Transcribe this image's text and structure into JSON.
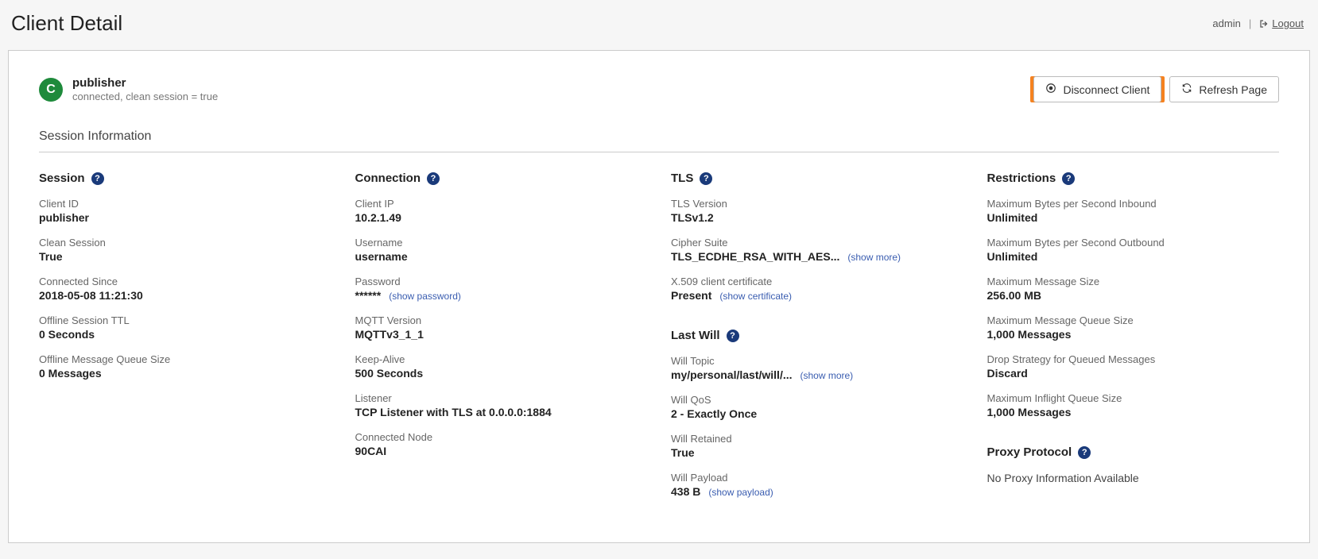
{
  "header": {
    "page_title": "Client Detail",
    "user": "admin",
    "logout": "Logout"
  },
  "client": {
    "avatar_letter": "C",
    "name": "publisher",
    "subtitle": "connected, clean session = true"
  },
  "buttons": {
    "disconnect": "Disconnect Client",
    "refresh": "Refresh Page"
  },
  "section_title": "Session Information",
  "groups": {
    "session": {
      "title": "Session",
      "client_id_label": "Client ID",
      "client_id": "publisher",
      "clean_session_label": "Clean Session",
      "clean_session": "True",
      "connected_since_label": "Connected Since",
      "connected_since": "2018-05-08 11:21:30",
      "offline_ttl_label": "Offline Session TTL",
      "offline_ttl": "0 Seconds",
      "offline_queue_label": "Offline Message Queue Size",
      "offline_queue": "0 Messages"
    },
    "connection": {
      "title": "Connection",
      "client_ip_label": "Client IP",
      "client_ip": "10.2.1.49",
      "username_label": "Username",
      "username": "username",
      "password_label": "Password",
      "password": "******",
      "password_link": "(show password)",
      "mqtt_version_label": "MQTT Version",
      "mqtt_version": "MQTTv3_1_1",
      "keep_alive_label": "Keep-Alive",
      "keep_alive": "500 Seconds",
      "listener_label": "Listener",
      "listener": "TCP Listener with TLS at 0.0.0.0:1884",
      "node_label": "Connected Node",
      "node": "90CAI"
    },
    "tls": {
      "title": "TLS",
      "version_label": "TLS Version",
      "version": "TLSv1.2",
      "cipher_label": "Cipher Suite",
      "cipher": "TLS_ECDHE_RSA_WITH_AES...",
      "cipher_link": "(show more)",
      "cert_label": "X.509 client certificate",
      "cert": "Present",
      "cert_link": "(show certificate)"
    },
    "last_will": {
      "title": "Last Will",
      "topic_label": "Will Topic",
      "topic": "my/personal/last/will/...",
      "topic_link": "(show more)",
      "qos_label": "Will QoS",
      "qos": "2 - Exactly Once",
      "retained_label": "Will Retained",
      "retained": "True",
      "payload_label": "Will Payload",
      "payload": "438 B",
      "payload_link": "(show payload)"
    },
    "restrictions": {
      "title": "Restrictions",
      "inbound_label": "Maximum Bytes per Second Inbound",
      "inbound": "Unlimited",
      "outbound_label": "Maximum Bytes per Second Outbound",
      "outbound": "Unlimited",
      "msg_size_label": "Maximum Message Size",
      "msg_size": "256.00 MB",
      "queue_size_label": "Maximum Message Queue Size",
      "queue_size": "1,000 Messages",
      "drop_label": "Drop Strategy for Queued Messages",
      "drop": "Discard",
      "inflight_label": "Maximum Inflight Queue Size",
      "inflight": "1,000 Messages"
    },
    "proxy": {
      "title": "Proxy Protocol",
      "none": "No Proxy Information Available"
    }
  }
}
